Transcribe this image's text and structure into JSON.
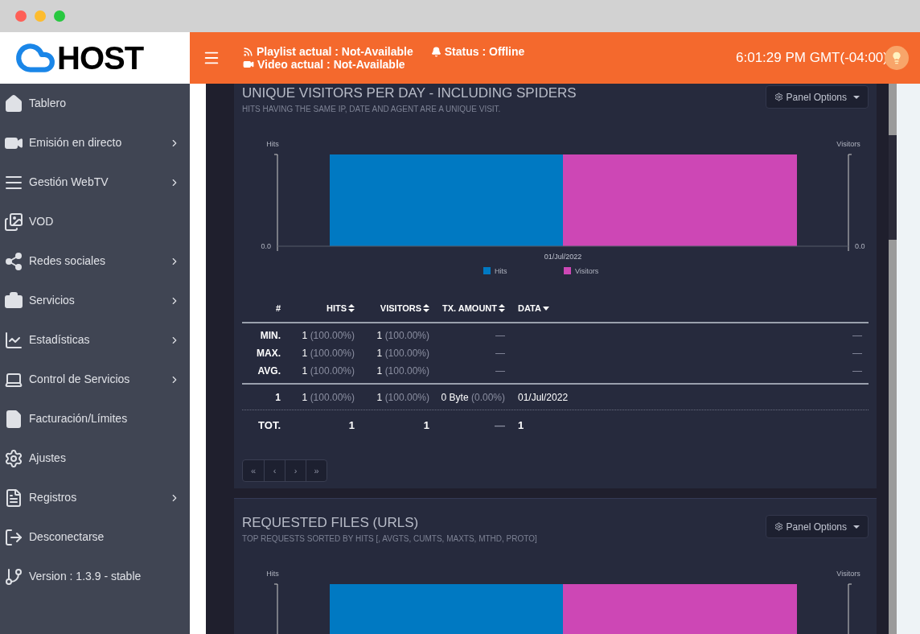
{
  "header": {
    "logo": "HOST",
    "playlist": "Playlist actual : Not-Available",
    "video": "Video actual : Not-Available",
    "status": "Status : Offline",
    "time": "6:01:29 PM GMT(-04:00)"
  },
  "sidebar": {
    "items": [
      {
        "label": "Tablero",
        "has_submenu": false
      },
      {
        "label": "Emisión en directo",
        "has_submenu": true
      },
      {
        "label": "Gestión WebTV",
        "has_submenu": true
      },
      {
        "label": "VOD",
        "has_submenu": false
      },
      {
        "label": "Redes sociales",
        "has_submenu": true
      },
      {
        "label": "Servicios",
        "has_submenu": true
      },
      {
        "label": "Estadísticas",
        "has_submenu": true
      },
      {
        "label": "Control de Servicios",
        "has_submenu": true
      },
      {
        "label": "Facturación/Límites",
        "has_submenu": false
      },
      {
        "label": "Ajustes",
        "has_submenu": false
      },
      {
        "label": "Registros",
        "has_submenu": true
      },
      {
        "label": "Desconectarse",
        "has_submenu": false
      },
      {
        "label": "Version : 1.3.9 - stable",
        "has_submenu": false
      }
    ]
  },
  "panels": [
    {
      "title": "UNIQUE VISITORS PER DAY - INCLUDING SPIDERS",
      "subtitle": "HITS HAVING THE SAME IP, DATE AND AGENT ARE A UNIQUE VISIT.",
      "options": "Panel Options",
      "chart": {
        "left_axis": "Hits",
        "right_axis": "Visitors",
        "left_tick": "0.0",
        "right_tick": "0.0",
        "category": "01/Jul/2022",
        "legend": [
          {
            "label": "Hits",
            "color": "#0079c2"
          },
          {
            "label": "Visitors",
            "color": "#cd47b5"
          }
        ]
      },
      "table": {
        "columns": [
          {
            "label": "#",
            "sortable": false,
            "sorted": false
          },
          {
            "label": "HITS",
            "sortable": true,
            "sorted": false
          },
          {
            "label": "VISITORS",
            "sortable": true,
            "sorted": false
          },
          {
            "label": "TX. AMOUNT",
            "sortable": true,
            "sorted": false
          },
          {
            "label": "DATA",
            "sortable": true,
            "sorted": true
          }
        ],
        "summary_rows": [
          {
            "label": "MIN.",
            "hits": "1",
            "hits_pct": "(100.00%)",
            "visitors": "1",
            "visitors_pct": "(100.00%)",
            "tx": "—",
            "last": "—"
          },
          {
            "label": "MAX.",
            "hits": "1",
            "hits_pct": "(100.00%)",
            "visitors": "1",
            "visitors_pct": "(100.00%)",
            "tx": "—",
            "last": "—"
          },
          {
            "label": "AVG.",
            "hits": "1",
            "hits_pct": "(100.00%)",
            "visitors": "1",
            "visitors_pct": "(100.00%)",
            "tx": "—",
            "last": "—"
          }
        ],
        "data_rows": [
          {
            "label": "1",
            "hits": "1",
            "hits_pct": "(100.00%)",
            "visitors": "1",
            "visitors_pct": "(100.00%)",
            "tx": "0 Byte",
            "tx_pct": "(0.00%)",
            "data": "01/Jul/2022"
          }
        ],
        "total": {
          "label": "TOT.",
          "hits": "1",
          "visitors": "1",
          "tx": "—",
          "data": "1"
        }
      },
      "pagination": [
        "«",
        "‹",
        "›",
        "»"
      ]
    },
    {
      "title": "REQUESTED FILES (URLS)",
      "subtitle": "TOP REQUESTS SORTED BY HITS [, AVGTS, CUMTS, MAXTS, MTHD, PROTO]",
      "options": "Panel Options",
      "chart": {
        "left_axis": "Hits",
        "right_axis": "Visitors",
        "bars": [
          {
            "color": "#0079c2"
          },
          {
            "color": "#cd47b5"
          }
        ]
      }
    }
  ]
}
